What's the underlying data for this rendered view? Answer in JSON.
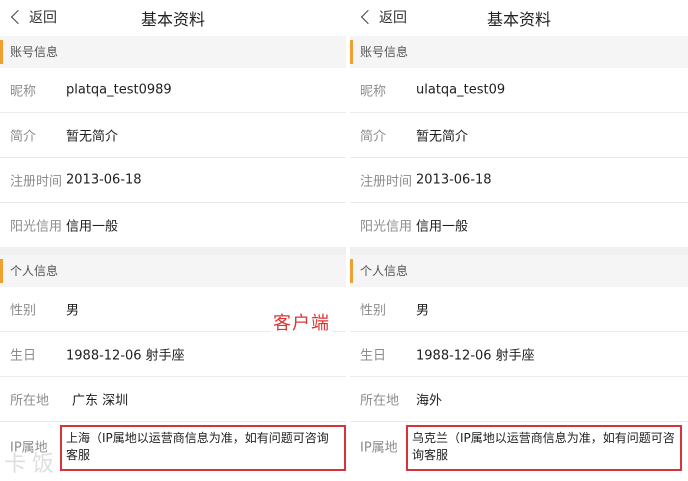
{
  "overlay_label": "客户端",
  "watermark": "卡饭",
  "panels": [
    {
      "nav": {
        "back_label": "返回",
        "title": "基本资料"
      },
      "account_section": "账号信息",
      "rows": [
        {
          "label": "昵称",
          "value": "platqa_test0989"
        },
        {
          "label": "简介",
          "value": "暂无简介"
        },
        {
          "label": "注册时间",
          "value": "2013-06-18"
        },
        {
          "label": "阳光信用",
          "value": "信用一般"
        }
      ],
      "personal_section": "个人信息",
      "personal_rows": [
        {
          "label": "性别",
          "value": "男"
        },
        {
          "label": "生日",
          "value": "1988-12-06 射手座"
        },
        {
          "label": "所在地",
          "value": "广东 深圳"
        }
      ],
      "ip": {
        "label": "IP属地",
        "value": "上海（IP属地以运营商信息为准，如有问题可咨询客服"
      }
    },
    {
      "nav": {
        "back_label": "返回",
        "title": "基本资料"
      },
      "account_section": "账号信息",
      "rows": [
        {
          "label": "昵称",
          "value": "ulatqa_test09"
        },
        {
          "label": "简介",
          "value": "暂无简介"
        },
        {
          "label": "注册时间",
          "value": "2013-06-18"
        },
        {
          "label": "阳光信用",
          "value": "信用一般"
        }
      ],
      "personal_section": "个人信息",
      "personal_rows": [
        {
          "label": "性别",
          "value": "男"
        },
        {
          "label": "生日",
          "value": "1988-12-06 射手座"
        },
        {
          "label": "所在地",
          "value": "海外"
        }
      ],
      "ip": {
        "label": "IP属地",
        "value": "乌克兰（IP属地以运营商信息为准，如有问题可咨询客服"
      }
    }
  ],
  "colors": {
    "accent": "#f0a030",
    "highlight_border": "#d6333a",
    "overlay_text": "#e03434"
  }
}
